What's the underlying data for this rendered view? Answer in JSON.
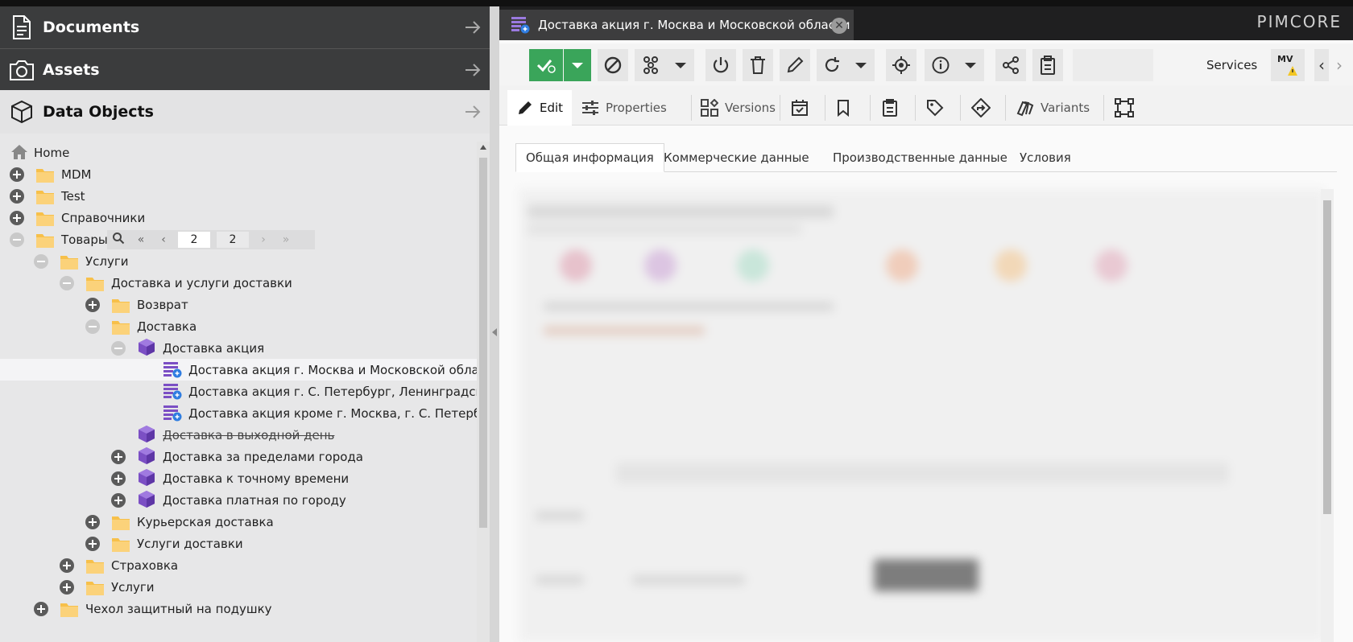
{
  "sidebar": {
    "panels": [
      {
        "title": "Documents"
      },
      {
        "title": "Assets"
      },
      {
        "title": "Data Objects"
      }
    ]
  },
  "tree": {
    "rows": [
      {
        "label": "Home"
      },
      {
        "label": "MDM"
      },
      {
        "label": "Test"
      },
      {
        "label": "Справочники"
      },
      {
        "label": "Товары"
      },
      {
        "label": "Услуги"
      },
      {
        "label": "Доставка и услуги доставки"
      },
      {
        "label": "Возврат"
      },
      {
        "label": "Доставка"
      },
      {
        "label": "Доставка акция"
      },
      {
        "label": "Доставка акция г. Москва и Московской области"
      },
      {
        "label": "Доставка акция г. С. Петербург, Ленинградской,"
      },
      {
        "label": "Доставка акция кроме г. Москва, г. С. Петербург"
      },
      {
        "label": "Доставка в выходной день"
      },
      {
        "label": "Доставка за пределами города"
      },
      {
        "label": "Доставка к точному времени"
      },
      {
        "label": "Доставка платная по городу"
      },
      {
        "label": "Курьерская доставка"
      },
      {
        "label": "Услуги доставки"
      },
      {
        "label": "Страховка"
      },
      {
        "label": "Услуги"
      },
      {
        "label": "Чехол защитный на подушку"
      }
    ],
    "pager": {
      "current": "2",
      "total": "2"
    }
  },
  "editor": {
    "tab_title": "Доставка акция г. Москва и Московской области",
    "brand": "PIMCORE",
    "services_label": "Services",
    "mv_label": "MV",
    "subtabs": {
      "edit": "Edit",
      "properties": "Properties",
      "versions": "Versions",
      "variants": "Variants"
    },
    "inner_tabs": [
      "Общая информация",
      "Коммерческие данные",
      "Производственные данные",
      "Условия"
    ]
  },
  "colors": {
    "accent_green": "#3aa55a",
    "object_purple": "#7b4fc4",
    "folder_yellow": "#f7c04a"
  }
}
